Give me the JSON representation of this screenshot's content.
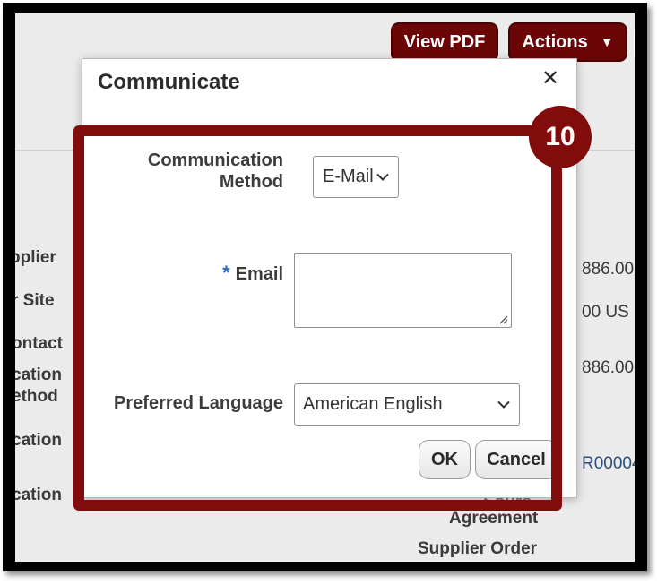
{
  "header": {
    "view_pdf_label": "View PDF",
    "actions_label": "Actions",
    "actions_caret": "▼"
  },
  "background": {
    "labels": {
      "supplier": "pplier",
      "supplier_site": "r Site",
      "contact": "ontact",
      "comm_method_1": "cation",
      "comm_method_2": "ethod",
      "location_1": "cation",
      "location_2": "cation"
    },
    "values": {
      "amount_1": "886.00",
      "amount_2": "00 US",
      "amount_3": "886.00",
      "order_ref": "R00004"
    },
    "bottom_labels": {
      "partial": "Sourc",
      "agreement": "Agreement",
      "supplier_order": "Supplier Order"
    }
  },
  "dialog": {
    "title": "Communicate",
    "close_icon": "close-icon",
    "communication_method": {
      "label_line1": "Communication",
      "label_line2": "Method",
      "selected": "E-Mail"
    },
    "email": {
      "required_marker": "*",
      "label": "Email",
      "value": ""
    },
    "preferred_language": {
      "label": "Preferred Language",
      "selected": "American English"
    },
    "ok_label": "OK",
    "cancel_label": "Cancel"
  },
  "annotation": {
    "step_number": "10",
    "color": "#820c0c"
  }
}
